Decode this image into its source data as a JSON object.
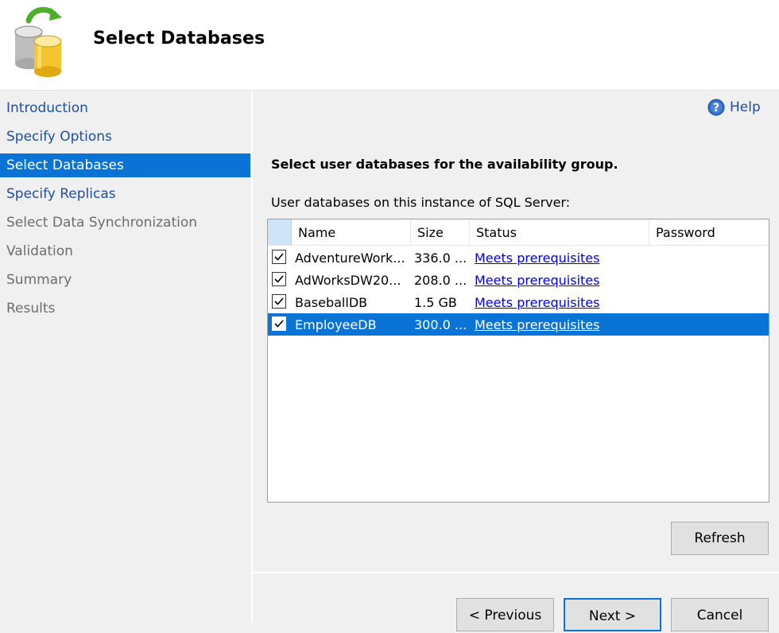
{
  "header": {
    "title": "Select Databases",
    "icon": "database-sync-icon"
  },
  "sidebar": {
    "items": [
      {
        "label": "Introduction",
        "state": "link"
      },
      {
        "label": "Specify Options",
        "state": "link"
      },
      {
        "label": "Select Databases",
        "state": "selected"
      },
      {
        "label": "Specify Replicas",
        "state": "link"
      },
      {
        "label": "Select Data Synchronization",
        "state": "disabled"
      },
      {
        "label": "Validation",
        "state": "disabled"
      },
      {
        "label": "Summary",
        "state": "disabled"
      },
      {
        "label": "Results",
        "state": "disabled"
      }
    ]
  },
  "main": {
    "help_label": "Help",
    "instruction": "Select user databases for the availability group.",
    "list_label": "User databases on this instance of SQL Server:",
    "columns": [
      "Name",
      "Size",
      "Status",
      "Password"
    ],
    "rows": [
      {
        "checked": true,
        "name": "AdventureWork...",
        "size": "336.0 ...",
        "status": "Meets prerequisites",
        "password": "",
        "selected": false
      },
      {
        "checked": true,
        "name": "AdWorksDW20...",
        "size": "208.0 ...",
        "status": "Meets prerequisites",
        "password": "",
        "selected": false
      },
      {
        "checked": true,
        "name": "BaseballDB",
        "size": "1.5 GB",
        "status": "Meets prerequisites",
        "password": "",
        "selected": false
      },
      {
        "checked": true,
        "name": "EmployeeDB",
        "size": "300.0 ...",
        "status": "Meets prerequisites",
        "password": "",
        "selected": true
      }
    ],
    "refresh_label": "Refresh"
  },
  "footer": {
    "previous_label": "< Previous",
    "next_label": "Next >",
    "cancel_label": "Cancel"
  },
  "colors": {
    "selection": "#0a74d6",
    "link": "#1f4ea3",
    "disabled": "#6d6d6d"
  }
}
